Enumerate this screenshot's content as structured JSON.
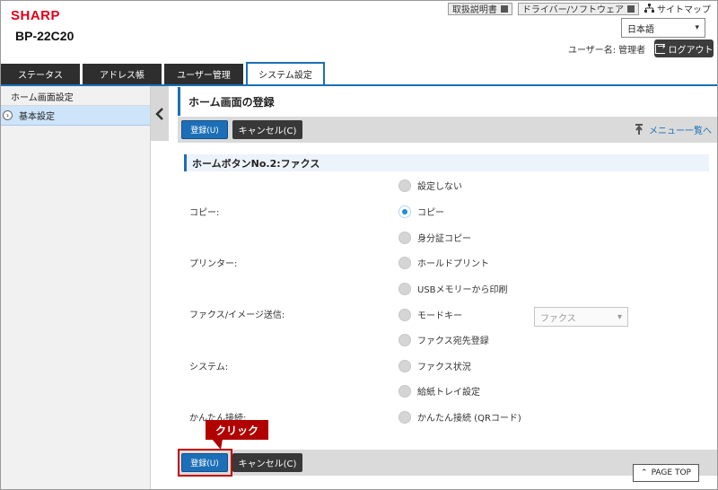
{
  "header": {
    "brand": "SHARP",
    "model": "BP-22C20",
    "links": [
      "取扱説明書",
      "ドライバー/ソフトウェア"
    ],
    "sitemap": "サイトマップ",
    "language": "日本語",
    "user_label": "ユーザー名:",
    "user_name": "管理者",
    "logout": "ログアウト"
  },
  "tabs": [
    {
      "label": "ステータス",
      "active": false
    },
    {
      "label": "アドレス帳",
      "active": false
    },
    {
      "label": "ユーザー管理",
      "active": false
    },
    {
      "label": "システム設定",
      "active": true
    }
  ],
  "sidebar": {
    "heading": "ホーム画面設定",
    "items": [
      {
        "label": "基本設定",
        "selected": true
      }
    ]
  },
  "main": {
    "title": "ホーム画面の登録",
    "register_button": "登録(U)",
    "cancel_button": "キャンセル(C)",
    "menu_link": "メニュー一覧へ",
    "section_title": "ホームボタンNo.2:ファクス",
    "categories": [
      "コピー:",
      "プリンター:",
      "ファクス/イメージ送信:",
      "システム:",
      "かんたん接続:"
    ],
    "options": [
      {
        "label": "設定しない",
        "checked": false
      },
      {
        "label": "コピー",
        "checked": true
      },
      {
        "label": "身分証コピー",
        "checked": false
      },
      {
        "label": "ホールドプリント",
        "checked": false
      },
      {
        "label": "USBメモリーから印刷",
        "checked": false
      },
      {
        "label": "モードキー",
        "checked": false
      },
      {
        "label": "ファクス宛先登録",
        "checked": false
      },
      {
        "label": "ファクス状況",
        "checked": false
      },
      {
        "label": "給紙トレイ設定",
        "checked": false
      },
      {
        "label": "かんたん接続 (QRコード)",
        "checked": false
      }
    ],
    "mode_select_value": "ファクス",
    "callout": "クリック",
    "page_top": "PAGE TOP"
  },
  "colors": {
    "accent": "#1b6fb6",
    "brand": "#e0001a",
    "callout": "#b00000"
  }
}
